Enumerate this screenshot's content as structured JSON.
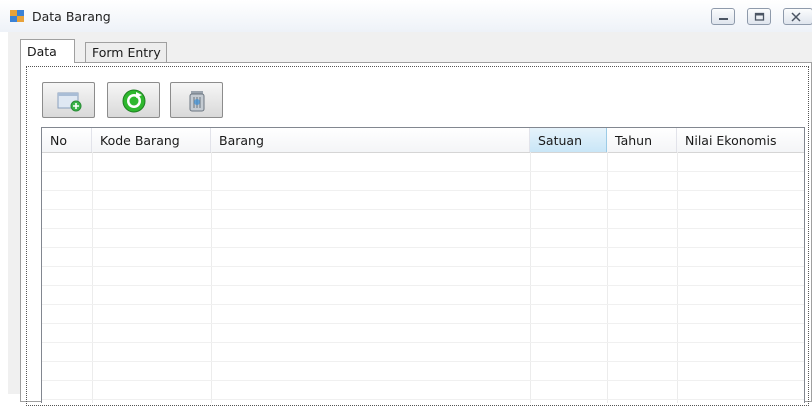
{
  "window": {
    "title": "Data Barang",
    "icon": "form-window-icon",
    "controls": [
      "minimize-icon",
      "maximize-icon",
      "close-icon"
    ]
  },
  "tabs": [
    {
      "label": "Data",
      "active": true
    },
    {
      "label": "Form Entry",
      "active": false
    }
  ],
  "toolbar": {
    "buttons": [
      {
        "name": "add-button",
        "icon": "add-record-icon"
      },
      {
        "name": "refresh-button",
        "icon": "refresh-icon"
      },
      {
        "name": "delete-button",
        "icon": "trash-icon"
      }
    ]
  },
  "grid": {
    "columns": [
      "No",
      "Kode Barang",
      "Barang",
      "Satuan",
      "Tahun",
      "Nilai Ekonomis"
    ],
    "selected_column": "Satuan",
    "rows": []
  },
  "colors": {
    "titlebar": "#eef2f8",
    "panel": "#f0f0f0",
    "header_selected": "#c9e6f7",
    "refresh_green": "#2eb82e"
  }
}
